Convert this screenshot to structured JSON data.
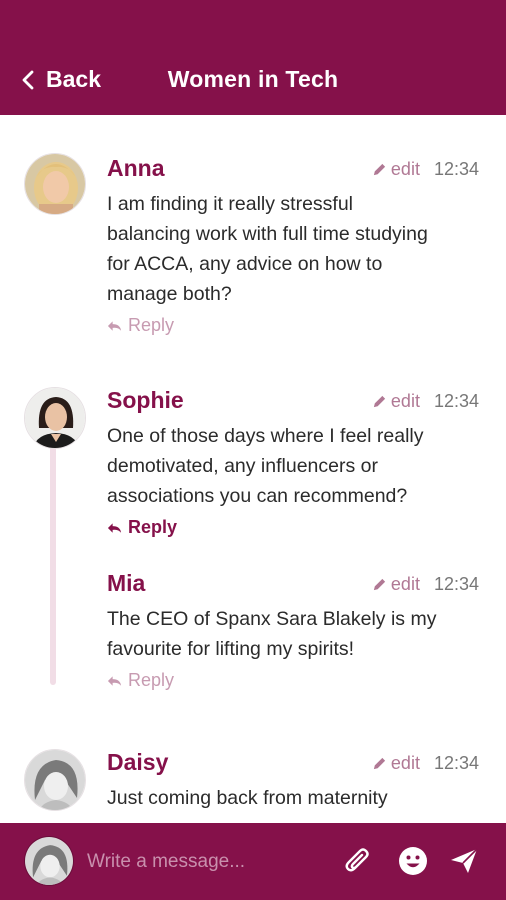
{
  "header": {
    "back_label": "Back",
    "title": "Women in Tech"
  },
  "messages": [
    {
      "name": "Anna",
      "edit_label": "edit",
      "time": "12:34",
      "lines": [
        "I am finding it really stressful",
        "balancing work with full time studying",
        "for ACCA, any advice on how to",
        "manage both?"
      ],
      "reply_label": "Reply"
    },
    {
      "name": "Sophie",
      "edit_label": "edit",
      "time": "12:34",
      "lines": [
        "One of those days where I feel really",
        "demotivated, any influencers or",
        "associations you can recommend?"
      ],
      "reply_label": "Reply"
    },
    {
      "name": "Mia",
      "edit_label": "edit",
      "time": "12:34",
      "lines": [
        "The CEO of Spanx Sara Blakely is my",
        "favourite for lifting my spirits!"
      ],
      "reply_label": "Reply"
    },
    {
      "name": "Daisy",
      "edit_label": "edit",
      "time": "12:34",
      "lines": [
        "Just coming back from maternity"
      ]
    }
  ],
  "composer": {
    "placeholder": "Write a message..."
  },
  "icons": {
    "back": "chevron-left-icon",
    "edit": "pencil-icon",
    "reply": "reply-arrow-icon",
    "attach": "paperclip-icon",
    "emoji": "smiley-icon",
    "send": "send-icon"
  },
  "colors": {
    "brand": "#85114a",
    "reply_muted": "#c79bb1",
    "edit": "#b07894",
    "thread_line": "#f1dde6"
  }
}
